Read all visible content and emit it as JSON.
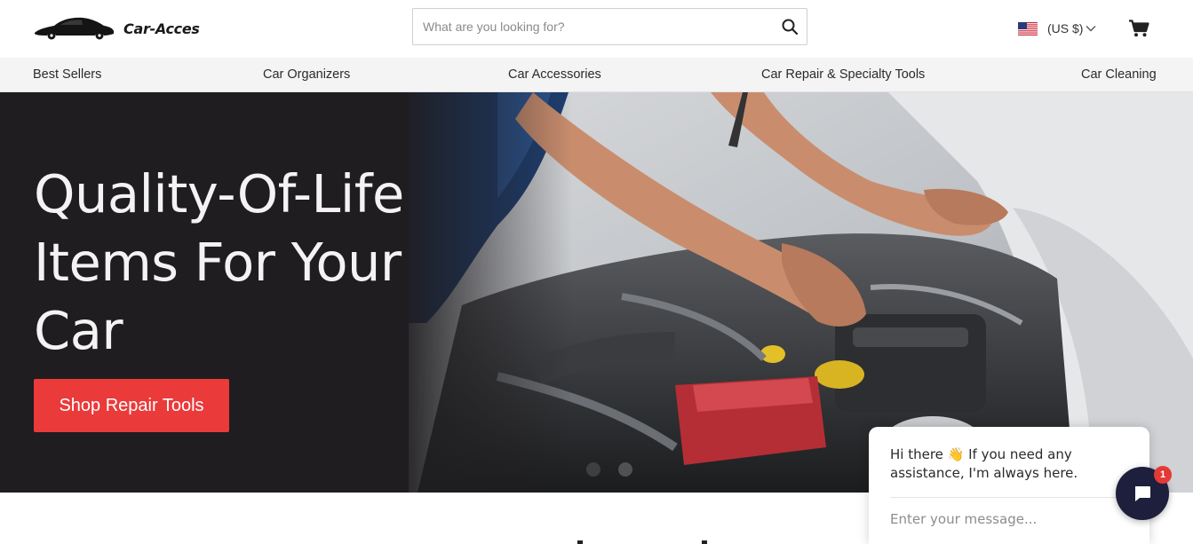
{
  "brand": {
    "name": "Car-Acces"
  },
  "search": {
    "placeholder": "What are you looking for?"
  },
  "currency": {
    "label": "(US $)"
  },
  "nav": {
    "items": [
      {
        "label": "Best Sellers"
      },
      {
        "label": "Car Organizers"
      },
      {
        "label": "Car Accessories"
      },
      {
        "label": "Car Repair & Specialty Tools"
      },
      {
        "label": "Car Cleaning"
      }
    ]
  },
  "hero": {
    "title": "Quality-Of-Life Items For Your Car",
    "cta": "Shop Repair Tools",
    "active_slide": 1,
    "slide_count": 2
  },
  "chat": {
    "message": "Hi there 👋 If you need any assistance, I'm always here.",
    "input_placeholder": "Enter your message...",
    "unread_count": "1"
  },
  "icons": {
    "logo": "car-silhouette-icon",
    "search": "search-icon",
    "flag": "us-flag-icon",
    "currency_toggle": "chevron-down-icon",
    "cart": "cart-icon",
    "chat": "chat-bubble-icon"
  },
  "colors": {
    "accent": "#ea3a3a",
    "hero_bg": "#1f1d20",
    "nav_bg": "#f4f4f4",
    "chat_launcher": "#1d1f3c",
    "badge": "#e53935"
  }
}
